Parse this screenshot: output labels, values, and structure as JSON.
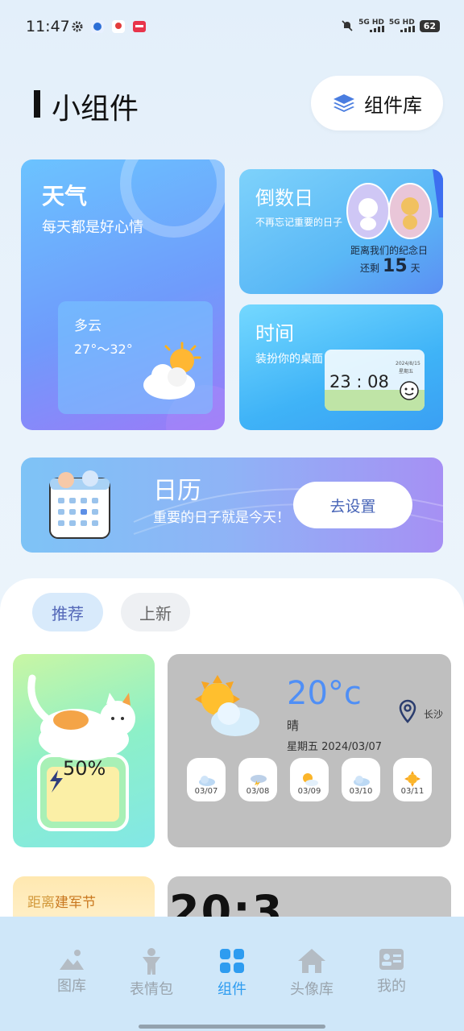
{
  "status": {
    "time": "11:47",
    "sig1": "5G HD",
    "sig2": "5G HD",
    "battery": "62"
  },
  "header": {
    "title": "小组件",
    "library_label": "组件库"
  },
  "weather_card": {
    "title": "天气",
    "subtitle": "每天都是好心情",
    "condition": "多云",
    "range": "27°～32°"
  },
  "countdown_card": {
    "title": "倒数日",
    "subtitle": "不再忘记重要的日子",
    "line1": "距离我们的纪念日",
    "remain_prefix": "还剩",
    "days": "15",
    "remain_suffix": "天"
  },
  "time_card": {
    "title": "时间",
    "subtitle": "装扮你的桌面",
    "clock": "23 : 08",
    "date": "2024/8/15",
    "weekday": "星期五"
  },
  "calendar_card": {
    "title": "日历",
    "subtitle": "重要的日子就是今天！",
    "button": "去设置"
  },
  "tabs": {
    "recommend": "推荐",
    "new": "上新"
  },
  "battery_widget": {
    "percent": "50%",
    "level": 0.5
  },
  "weather_widget": {
    "temp": "20°c",
    "condition": "晴",
    "date": "星期五 2024/03/07",
    "city": "长沙",
    "days": [
      {
        "date": "03/07",
        "icon": "cloud-icon"
      },
      {
        "date": "03/08",
        "icon": "thunder-icon"
      },
      {
        "date": "03/09",
        "icon": "partly-sunny-icon"
      },
      {
        "date": "03/10",
        "icon": "cloud-icon"
      },
      {
        "date": "03/11",
        "icon": "sun-icon"
      }
    ]
  },
  "army_widget": {
    "prefix": "距离",
    "name": "建军节"
  },
  "clock_widget": {
    "text": "20:3"
  },
  "nav": {
    "gallery": "图库",
    "stickers": "表情包",
    "widgets": "组件",
    "avatars": "头像库",
    "mine": "我的"
  },
  "colors": {
    "accent": "#2e9cf0",
    "nav_bg": "#cfe7f9",
    "weather_temp": "#4f8ff6"
  }
}
